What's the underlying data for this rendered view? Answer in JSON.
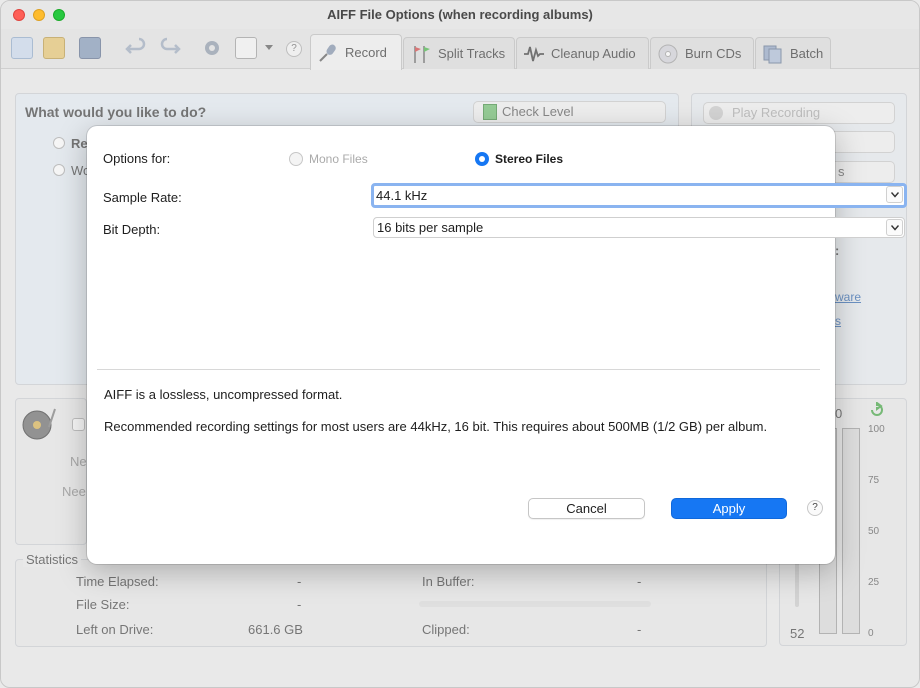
{
  "window": {
    "title": "AIFF File Options (when recording albums)"
  },
  "toolbar": {
    "help_label": "?",
    "tabs": [
      {
        "label": "Record"
      },
      {
        "label": "Split Tracks"
      },
      {
        "label": "Cleanup Audio"
      },
      {
        "label": "Burn CDs"
      },
      {
        "label": "Batch"
      }
    ]
  },
  "background": {
    "question": "What would you like to do?",
    "check_level": "Check Level",
    "play_recording": "Play Recording",
    "radio1_partial": "Re",
    "radio2_partial": "Wo",
    "link1_partial": "ware",
    "link2_partial": "s",
    "side_partial_s": "s",
    "side_partial_colon": ":",
    "need1_partial": "Ne",
    "need2_partial": "Nee",
    "statistics": {
      "title": "Statistics",
      "time_elapsed_label": "Time Elapsed:",
      "time_elapsed_value": "-",
      "file_size_label": "File Size:",
      "file_size_value": "-",
      "left_on_drive_label": "Left on Drive:",
      "left_on_drive_value": "661.6 GB",
      "in_buffer_label": "In Buffer:",
      "in_buffer_value": "-",
      "clipped_label": "Clipped:",
      "clipped_value": "-"
    },
    "meter": {
      "top_partial": "0",
      "bottom_value": "52",
      "ticks": [
        "100",
        "75",
        "50",
        "25",
        "0"
      ]
    }
  },
  "dialog": {
    "options_for_label": "Options for:",
    "mono_label": "Mono Files",
    "stereo_label": "Stereo Files",
    "sample_rate_label": "Sample Rate:",
    "sample_rate_value": "44.1 kHz",
    "bit_depth_label": "Bit Depth:",
    "bit_depth_value": "16 bits per sample",
    "note1": "AIFF is a lossless, uncompressed format.",
    "note2": "Recommended recording settings for most users are 44kHz, 16 bit.  This requires about 500MB (1/2 GB) per album.",
    "cancel_label": "Cancel",
    "apply_label": "Apply",
    "help_label": "?"
  },
  "colors": {
    "accent": "#1677f3",
    "focus_ring": "#8ab4f0"
  }
}
